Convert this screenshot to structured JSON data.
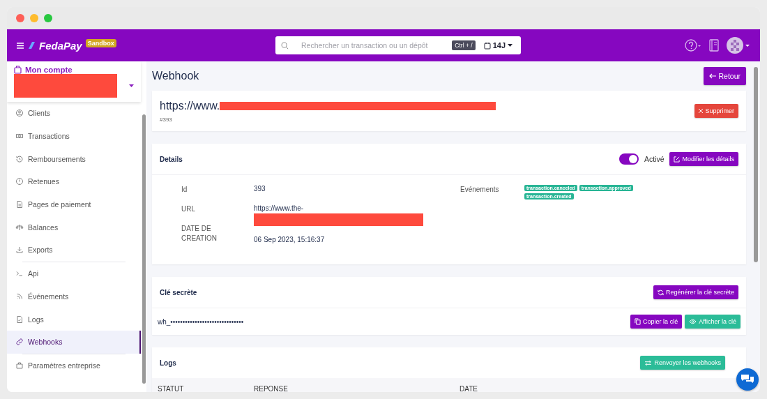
{
  "header": {
    "brand": "FedaPay",
    "badge": "Sandbox",
    "search": {
      "placeholder": "Rechercher un transaction ou un dépôt"
    },
    "shortcut": "Ctrl + /",
    "period": "14J"
  },
  "sidebar": {
    "account": "Mon compte",
    "groups": [
      [
        {
          "label": "Clients",
          "selected": false
        },
        {
          "label": "Transactions",
          "selected": false
        },
        {
          "label": "Remboursements",
          "selected": false
        },
        {
          "label": "Retenues",
          "selected": false
        },
        {
          "label": "Pages de paiement",
          "selected": false
        },
        {
          "label": "Balances",
          "selected": false
        },
        {
          "label": "Exports",
          "selected": false
        }
      ],
      [
        {
          "label": "Api",
          "selected": false
        },
        {
          "label": "Événements",
          "selected": false
        },
        {
          "label": "Logs",
          "selected": false
        },
        {
          "label": "Webhooks",
          "selected": true
        }
      ],
      [
        {
          "label": "Paramètres entreprise",
          "selected": false
        }
      ]
    ]
  },
  "page": {
    "title": "Webhook",
    "back_button": "Retour"
  },
  "webhook": {
    "url": "https://www.",
    "number": "#393",
    "delete_button": "Supprimer"
  },
  "details": {
    "title": "Details",
    "active": {
      "on": true,
      "label": "Activé"
    },
    "edit_button": "Modifier les détails",
    "fields": [
      {
        "label": "Id",
        "value": "393"
      },
      {
        "label": "URL",
        "value": "https://www.the-"
      },
      {
        "label": "DATE DE CREATION",
        "value": "06 Sep 2023, 15:16:37"
      }
    ],
    "events_label": "Evénements",
    "events": [
      "transaction.canceled",
      "transaction.approved",
      "transaction.created"
    ]
  },
  "secret": {
    "title": "Clé secrète",
    "regenerate_button": "Regénérer la clé secrète",
    "key": "wh_••••••••••••••••••••••••••••••",
    "copy_button": "Copier la clé",
    "show_button": "Afficher la clé"
  },
  "logs": {
    "title": "Logs",
    "resend_button": "Renvoyer les webhooks",
    "columns": [
      "STATUT",
      "REPONSE",
      "DATE"
    ]
  }
}
